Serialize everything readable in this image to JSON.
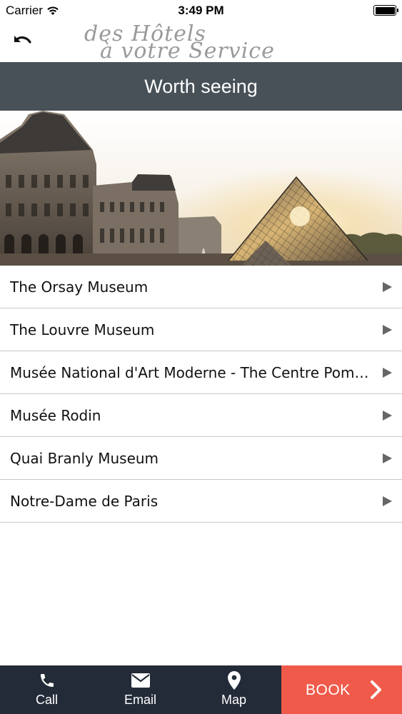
{
  "status_bar": {
    "carrier": "Carrier",
    "time": "3:49 PM"
  },
  "header": {
    "brand_line1": "des Hôtels",
    "brand_line2": "à votre Service",
    "back_icon": "undo-arrow-icon"
  },
  "page": {
    "title": "Worth seeing",
    "hero_image": "louvre-pyramid-photo"
  },
  "list": {
    "items": [
      {
        "label": "The Orsay Museum"
      },
      {
        "label": "The Louvre Museum"
      },
      {
        "label": "Musée National d'Art Moderne - The Centre Pompidou"
      },
      {
        "label": "Musée Rodin"
      },
      {
        "label": "Quai Branly Museum"
      },
      {
        "label": "Notre-Dame de Paris"
      }
    ]
  },
  "tab_bar": {
    "call_label": "Call",
    "email_label": "Email",
    "map_label": "Map",
    "book_label": "BOOK"
  },
  "colors": {
    "title_bar_bg": "#485157",
    "tab_bar_bg": "#242b38",
    "book_bg": "#ef5a4a"
  }
}
